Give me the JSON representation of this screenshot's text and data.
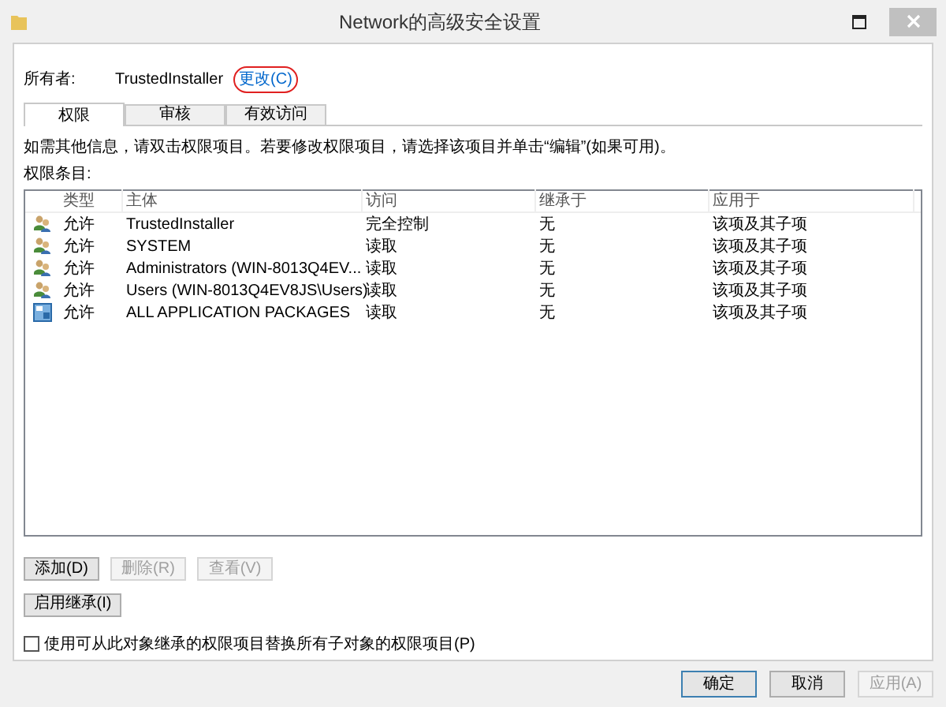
{
  "window": {
    "title": "Network的高级安全设置"
  },
  "owner": {
    "label": "所有者:",
    "value": "TrustedInstaller",
    "change_link": "更改(C)"
  },
  "tabs": [
    {
      "label": "权限",
      "selected": true
    },
    {
      "label": "审核",
      "selected": false
    },
    {
      "label": "有效访问",
      "selected": false
    }
  ],
  "info_text": "如需其他信息，请双击权限项目。若要修改权限项目，请选择该项目并单击“编辑”(如果可用)。",
  "entries_label": "权限条目:",
  "table": {
    "columns": [
      "类型",
      "主体",
      "访问",
      "继承于",
      "应用于"
    ],
    "rows": [
      {
        "kind": "user",
        "cells": [
          "允许",
          "TrustedInstaller",
          "完全控制",
          "无",
          "该项及其子项"
        ]
      },
      {
        "kind": "user",
        "cells": [
          "允许",
          "SYSTEM",
          "读取",
          "无",
          "该项及其子项"
        ]
      },
      {
        "kind": "user",
        "cells": [
          "允许",
          "Administrators (WIN-8013Q4EV...",
          "读取",
          "无",
          "该项及其子项"
        ]
      },
      {
        "kind": "user",
        "cells": [
          "允许",
          "Users (WIN-8013Q4EV8JS\\Users)",
          "读取",
          "无",
          "该项及其子项"
        ]
      },
      {
        "kind": "package",
        "cells": [
          "允许",
          "ALL APPLICATION PACKAGES",
          "读取",
          "无",
          "该项及其子项"
        ]
      }
    ]
  },
  "entry_buttons": [
    {
      "label": "添加(D)",
      "disabled": false
    },
    {
      "label": "删除(R)",
      "disabled": true
    },
    {
      "label": "查看(V)",
      "disabled": true
    }
  ],
  "inheritance_button": {
    "label": "启用继承(I)",
    "disabled": false
  },
  "replace_checkbox": {
    "label": "使用可从此对象继承的权限项目替换所有子对象的权限项目(P)",
    "checked": false
  },
  "dialog_buttons": [
    {
      "label": "确定",
      "disabled": false,
      "default": true
    },
    {
      "label": "取消",
      "disabled": false,
      "default": false
    },
    {
      "label": "应用(A)",
      "disabled": true,
      "default": false
    }
  ]
}
